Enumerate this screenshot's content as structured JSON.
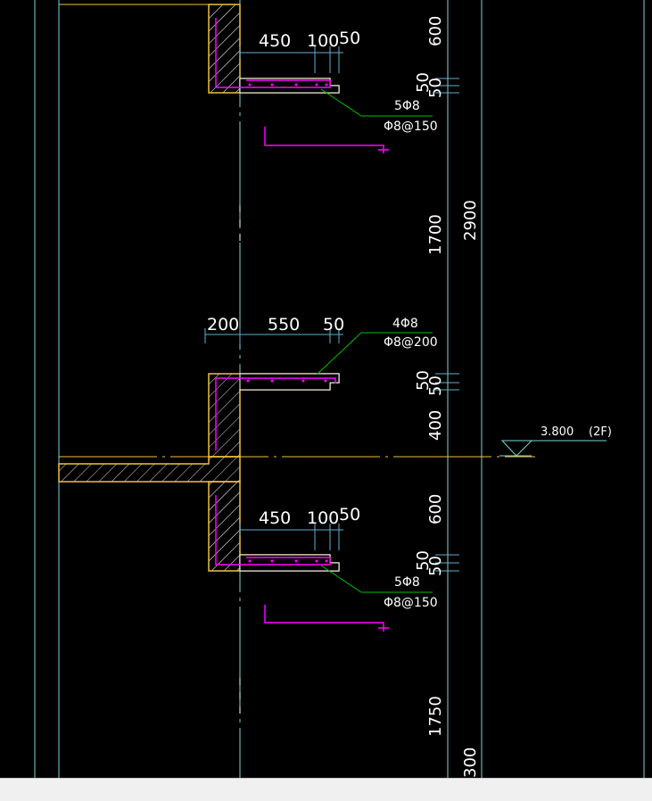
{
  "drawing": {
    "upper_section": {
      "dims_h": [
        "450",
        "100",
        "50"
      ],
      "dims_v": [
        "600",
        "50",
        "50"
      ],
      "rebar_count": "5Φ8",
      "rebar_spacing": "Φ8@150"
    },
    "middle_section": {
      "dims_h": [
        "200",
        "550",
        "50"
      ],
      "dims_v": [
        "50",
        "50",
        "400"
      ],
      "rebar_count": "4Φ8",
      "rebar_spacing": "Φ8@200"
    },
    "lower_section": {
      "dims_h": [
        "450",
        "100",
        "50"
      ],
      "dims_v": [
        "600",
        "50",
        "50"
      ],
      "rebar_count": "5Φ8",
      "rebar_spacing": "Φ8@150"
    },
    "vertical_dims": {
      "upper_clear": "1700",
      "story_height": "2900",
      "lower_clear": "1750",
      "partial": "300"
    },
    "level_marker": {
      "elevation": "3.800",
      "floor": "(2F)"
    }
  },
  "colors": {
    "background": "#000000",
    "gridline": "#7fd4d4",
    "concrete_outline": "#f0c040",
    "rebar": "#ff00ff",
    "leader": "#00c000",
    "dimension": "#5fb0d0",
    "text": "#ffffff"
  }
}
